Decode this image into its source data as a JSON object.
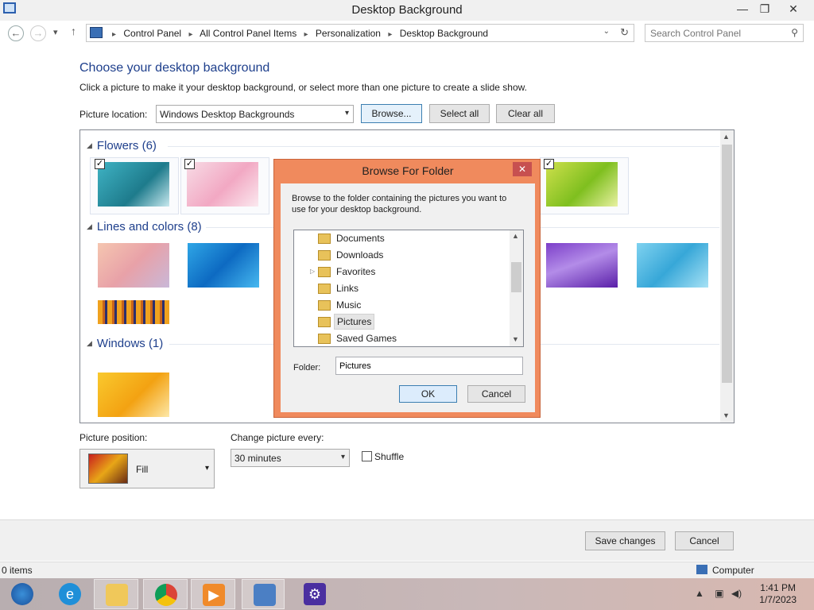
{
  "window": {
    "title": "Desktop Background",
    "controls": {
      "minimize": "—",
      "restore": "❐",
      "close": "✕"
    }
  },
  "navbar": {
    "back": "←",
    "forward": "→",
    "recent": "▾",
    "up": "↑",
    "breadcrumbs": [
      "Control Panel",
      "All Control Panel Items",
      "Personalization",
      "Desktop Background"
    ],
    "separator": "▸",
    "dropdown": "⌄",
    "refresh": "↻",
    "search_placeholder": "Search Control Panel",
    "search_icon": "⚲"
  },
  "main": {
    "heading": "Choose your desktop background",
    "subtext": "Click a picture to make it your desktop background, or select more than one picture to create a slide show.",
    "location_label": "Picture location:",
    "location_value": "Windows Desktop Backgrounds",
    "browse_label": "Browse...",
    "select_all_label": "Select all",
    "clear_all_label": "Clear all"
  },
  "gallery": {
    "groups": [
      {
        "title": "Flowers (6)"
      },
      {
        "title": "Lines and colors (8)"
      },
      {
        "title": "Windows (1)"
      }
    ],
    "checkmark": "✓"
  },
  "dialog": {
    "title": "Browse For Folder",
    "close": "✕",
    "instructions": "Browse to the folder containing the pictures you want to use for your desktop background.",
    "tree": [
      {
        "label": "Documents",
        "expander": ""
      },
      {
        "label": "Downloads",
        "expander": ""
      },
      {
        "label": "Favorites",
        "expander": "▷"
      },
      {
        "label": "Links",
        "expander": ""
      },
      {
        "label": "Music",
        "expander": ""
      },
      {
        "label": "Pictures",
        "expander": "",
        "selected": true
      },
      {
        "label": "Saved Games",
        "expander": ""
      }
    ],
    "folder_label": "Folder:",
    "folder_value": "Pictures",
    "ok_label": "OK",
    "cancel_label": "Cancel"
  },
  "settings": {
    "position_label": "Picture position:",
    "position_value": "Fill",
    "change_label": "Change picture every:",
    "change_value": "30 minutes",
    "shuffle_label": "Shuffle"
  },
  "footer": {
    "save_label": "Save changes",
    "cancel_label": "Cancel"
  },
  "statusbar": {
    "items": "0 items",
    "computer": "Computer"
  },
  "taskbar": {
    "time": "1:41 PM",
    "date": "1/7/2023",
    "tray_up": "▲"
  }
}
